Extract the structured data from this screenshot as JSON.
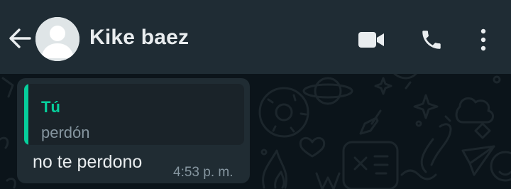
{
  "header": {
    "back_icon": "arrow-left-icon",
    "avatar_icon": "default-avatar-icon",
    "contact_name": "Kike baez",
    "video_icon": "video-camera-icon",
    "call_icon": "phone-icon",
    "menu_icon": "more-vertical-icon"
  },
  "message": {
    "quote": {
      "author": "Tú",
      "text": "perdón"
    },
    "text": "no te perdono",
    "time": "4:53 p. m."
  },
  "colors": {
    "header_bg": "#1f2c34",
    "chat_bg": "#0b141a",
    "bubble_bg": "#202c33",
    "quote_accent": "#06cf9c",
    "primary_text": "#e9edef",
    "secondary_text": "#8696a0"
  }
}
